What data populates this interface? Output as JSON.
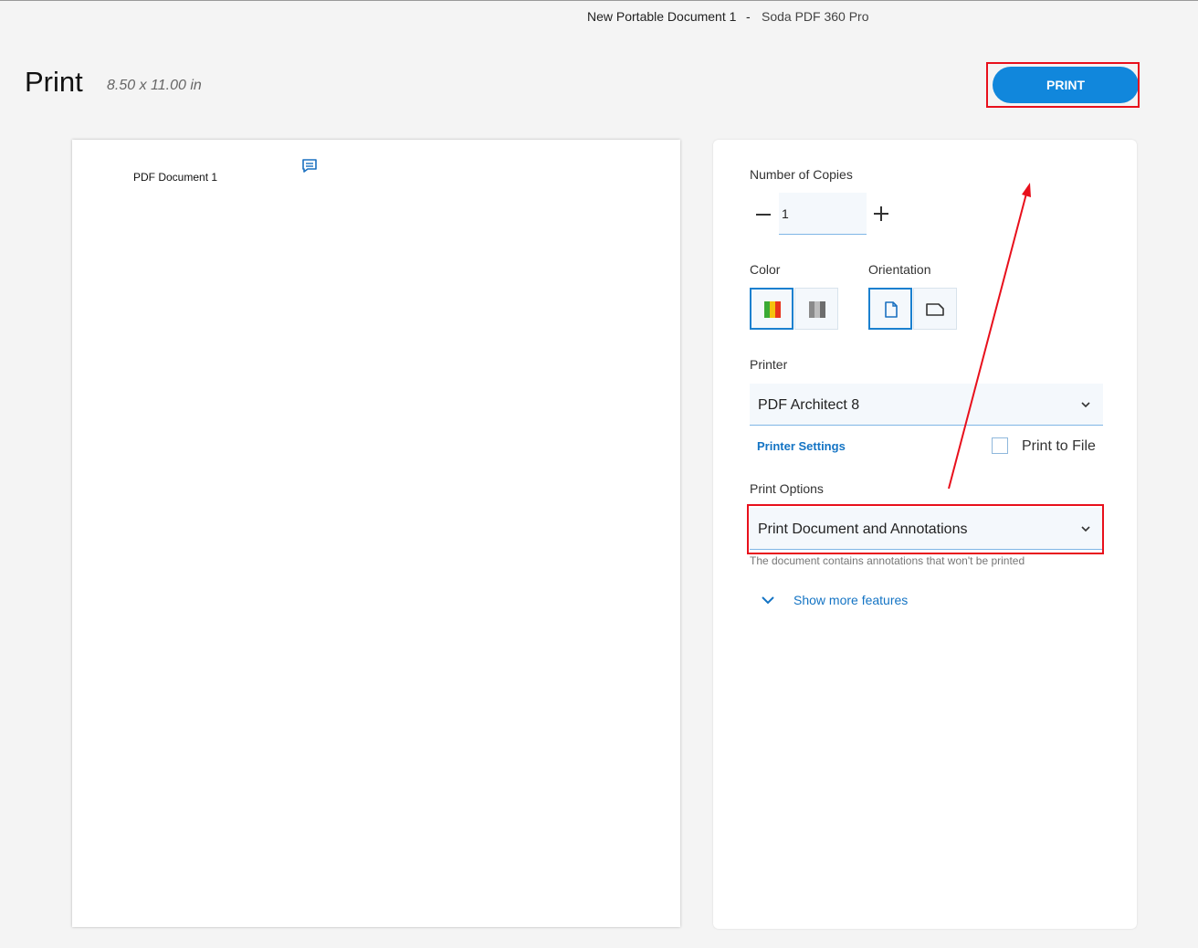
{
  "window": {
    "title_doc": "New Portable Document 1",
    "separator": "-",
    "title_app": "Soda PDF 360 Pro"
  },
  "header": {
    "title": "Print",
    "page_size": "8.50 x 11.00 in",
    "print_button": "PRINT"
  },
  "preview": {
    "document_text": "PDF Document 1",
    "annotation_icon": "comment-icon"
  },
  "panel": {
    "copies": {
      "label": "Number of Copies",
      "value": "1"
    },
    "color": {
      "label": "Color",
      "options": [
        "color-icon",
        "grayscale-icon"
      ],
      "selected": "color-icon"
    },
    "orientation": {
      "label": "Orientation",
      "options": [
        "portrait-icon",
        "landscape-icon"
      ],
      "selected": "portrait-icon"
    },
    "printer": {
      "label": "Printer",
      "value": "PDF Architect 8",
      "settings_link": "Printer Settings",
      "print_to_file_label": "Print to File",
      "print_to_file_checked": false
    },
    "print_options": {
      "label": "Print Options",
      "value": "Print Document and Annotations",
      "hint": "The document contains annotations that won't be printed"
    },
    "more": {
      "label": "Show more features"
    }
  },
  "annotation_colors": {
    "highlight_box": "#e8101c",
    "arrow": "#e8101c"
  },
  "colors": {
    "accent": "#1187dc",
    "link": "#1474c4"
  }
}
